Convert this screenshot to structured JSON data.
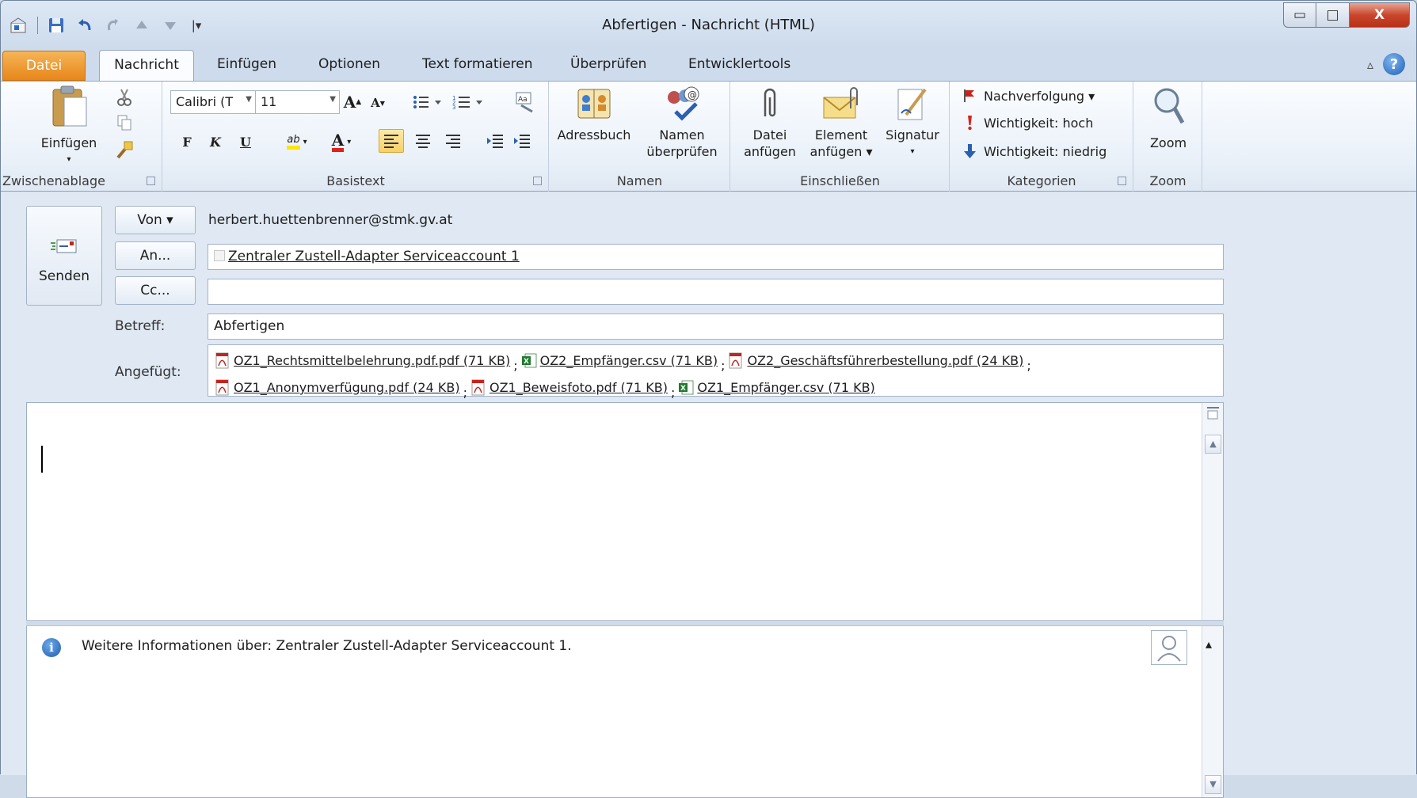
{
  "window": {
    "title": "Abfertigen - Nachricht (HTML)",
    "min_glyph": "▭",
    "max_glyph": "□",
    "close_glyph": "X"
  },
  "qat": {
    "more": "|▾"
  },
  "tabs": {
    "file": "Datei",
    "items": [
      "Nachricht",
      "Einfügen",
      "Optionen",
      "Text formatieren",
      "Überprüfen",
      "Entwicklertools"
    ],
    "collapse_glyph": "▵",
    "help_glyph": "?"
  },
  "ribbon": {
    "clipboard": {
      "label": "Zwischenablage",
      "paste": "Einfügen"
    },
    "basic_text": {
      "label": "Basistext",
      "font": "Calibri (T",
      "size": "11",
      "grow": "A",
      "shrink": "A",
      "bold": "F",
      "italic": "K",
      "underline": "U",
      "highlight": "ab",
      "font_color": "A"
    },
    "names": {
      "label": "Namen",
      "address_book": "Adressbuch",
      "check_names_1": "Namen",
      "check_names_2": "überprüfen"
    },
    "include": {
      "label": "Einschließen",
      "attach_file_1": "Datei",
      "attach_file_2": "anfügen",
      "attach_item_1": "Element",
      "attach_item_2": "anfügen ▾",
      "signature": "Signatur"
    },
    "tags": {
      "label": "Kategorien",
      "follow_up": "Nachverfolgung ▾",
      "high": "Wichtigkeit: hoch",
      "low": "Wichtigkeit: niedrig"
    },
    "zoom": {
      "label": "Zoom",
      "button": "Zoom"
    }
  },
  "compose": {
    "send": "Senden",
    "from_button": "Von ▾",
    "from_value": "herbert.huettenbrenner@stmk.gv.at",
    "to_button": "An...",
    "to_value": "Zentraler Zustell-Adapter Serviceaccount 1",
    "cc_button": "Cc...",
    "cc_value": "",
    "subject_label": "Betreff:",
    "subject_value": "Abfertigen",
    "attached_label": "Angefügt:",
    "attachments": [
      {
        "name": "OZ1_Rechtsmittelbelehrung.pdf.pdf (71 KB)",
        "type": "pdf",
        "sep": ";"
      },
      {
        "name": "OZ2_Empfänger.csv (71 KB)",
        "type": "csv",
        "sep": ";"
      },
      {
        "name": "OZ2_Geschäftsführerbestellung.pdf (24 KB)",
        "type": "pdf",
        "sep": ";"
      },
      {
        "name": "OZ1_Anonymverfügung.pdf (24 KB)",
        "type": "pdf",
        "sep": ";"
      },
      {
        "name": "OZ1_Beweisfoto.pdf (71 KB)",
        "type": "pdf",
        "sep": ";"
      },
      {
        "name": "OZ1_Empfänger.csv (71 KB)",
        "type": "csv",
        "sep": ""
      }
    ]
  },
  "infobar": {
    "text": "Weitere Informationen über: Zentraler Zustell-Adapter Serviceaccount 1.",
    "expand_glyph": "▴"
  },
  "colors": {
    "file_tab": "#e7861b",
    "accent": "#1f5fb4",
    "pdf": "#c8231b",
    "csv": "#1f7a2e"
  }
}
